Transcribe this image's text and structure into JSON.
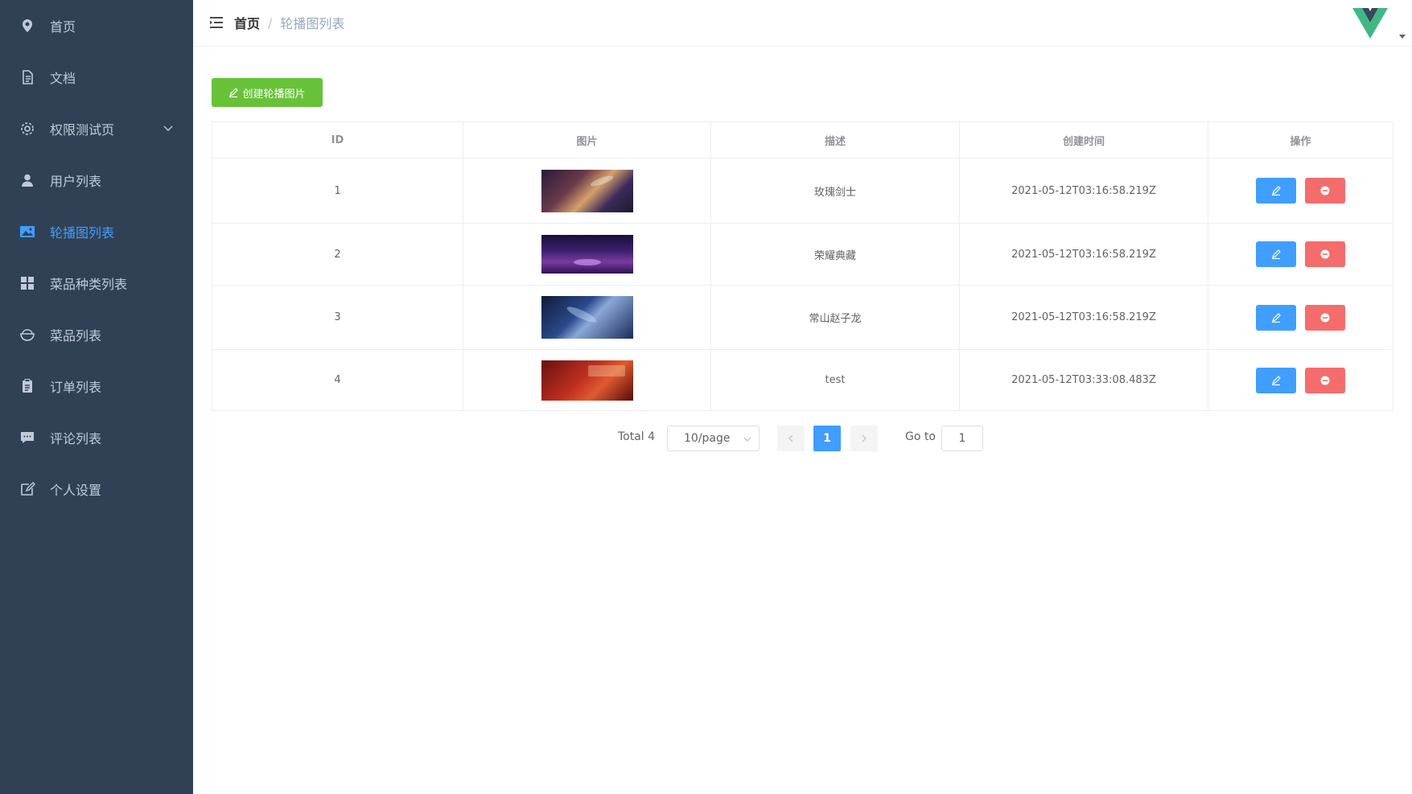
{
  "sidebar": {
    "items": [
      {
        "label": "首页",
        "icon": "location-pin-icon"
      },
      {
        "label": "文档",
        "icon": "document-icon"
      },
      {
        "label": "权限测试页",
        "icon": "gear-icon"
      },
      {
        "label": "用户列表",
        "icon": "user-icon"
      },
      {
        "label": "轮播图列表",
        "icon": "picture-icon"
      },
      {
        "label": "菜品种类列表",
        "icon": "grid-icon"
      },
      {
        "label": "菜品列表",
        "icon": "bowl-icon"
      },
      {
        "label": "订单列表",
        "icon": "clipboard-icon"
      },
      {
        "label": "评论列表",
        "icon": "comment-icon"
      },
      {
        "label": "个人设置",
        "icon": "edit-icon"
      }
    ],
    "active_index": 4
  },
  "header": {
    "breadcrumb": {
      "home": "首页",
      "separator": "/",
      "current": "轮播图列表"
    }
  },
  "main": {
    "create_button_label": "创建轮播图片",
    "table": {
      "columns": [
        "ID",
        "图片",
        "描述",
        "创建时间",
        "操作"
      ],
      "rows": [
        {
          "id": "1",
          "description": "玫瑰剑士",
          "created_at": "2021-05-12T03:16:58.219Z"
        },
        {
          "id": "2",
          "description": "荣耀典藏",
          "created_at": "2021-05-12T03:16:58.219Z"
        },
        {
          "id": "3",
          "description": "常山赵子龙",
          "created_at": "2021-05-12T03:16:58.219Z"
        },
        {
          "id": "4",
          "description": "test",
          "created_at": "2021-05-12T03:33:08.483Z"
        }
      ]
    },
    "pagination": {
      "total_label": "Total 4",
      "page_size": "10/page",
      "current_page": "1",
      "goto_label": "Go to",
      "goto_value": "1"
    }
  },
  "colors": {
    "sidebar_bg": "#304156",
    "sidebar_text": "#bfcbd9",
    "active": "#409eff",
    "create_button": "#67c23a",
    "edit_button": "#409eff",
    "delete_button": "#f56c6c"
  }
}
